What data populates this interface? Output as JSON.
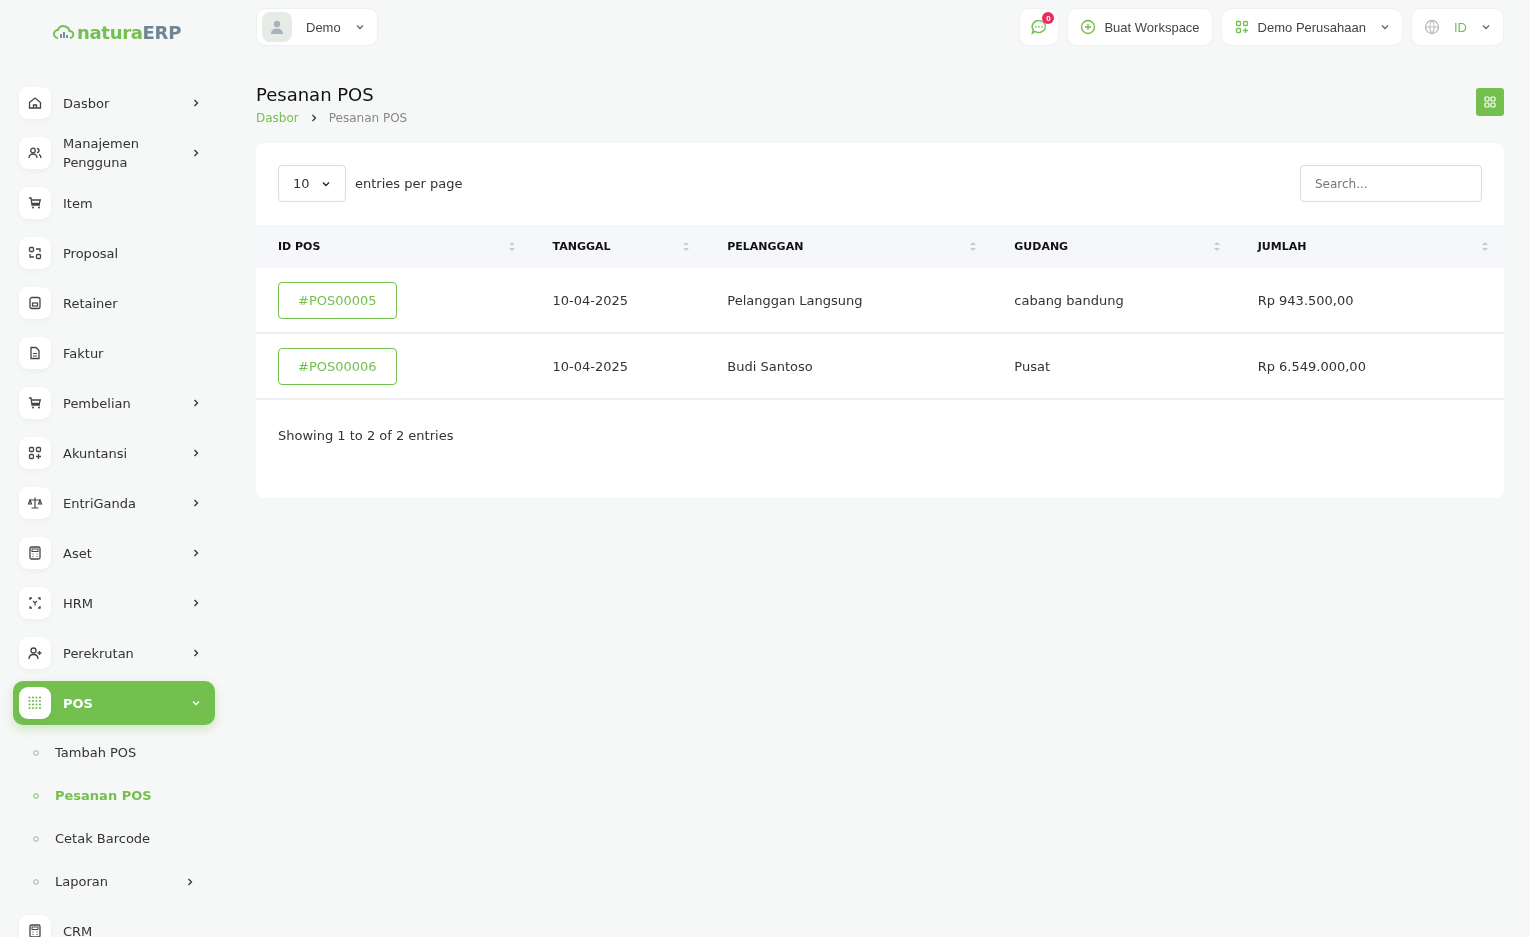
{
  "logo": {
    "part_1": "natura",
    "part_2": "ERP"
  },
  "user_menu": {
    "label": "Demo"
  },
  "topbar": {
    "notification_count": "0",
    "create_workspace": "Buat Workspace",
    "company": "Demo Perusahaan",
    "language": "ID"
  },
  "sidebar": {
    "items": [
      {
        "label": "Dasbor",
        "kind": "home",
        "expandable": true,
        "selected": false
      },
      {
        "label": "Manajemen Pengguna",
        "kind": "users",
        "expandable": true,
        "selected": false
      },
      {
        "label": "Item",
        "kind": "cart",
        "expandable": false,
        "selected": false
      },
      {
        "label": "Proposal",
        "kind": "swap",
        "expandable": false,
        "selected": false
      },
      {
        "label": "Retainer",
        "kind": "save",
        "expandable": false,
        "selected": false
      },
      {
        "label": "Faktur",
        "kind": "file",
        "expandable": false,
        "selected": false
      },
      {
        "label": "Pembelian",
        "kind": "cart",
        "expandable": true,
        "selected": false
      },
      {
        "label": "Akuntansi",
        "kind": "grid",
        "expandable": true,
        "selected": false
      },
      {
        "label": "EntriGanda",
        "kind": "scale",
        "expandable": true,
        "selected": false
      },
      {
        "label": "Aset",
        "kind": "calc",
        "expandable": true,
        "selected": false
      },
      {
        "label": "HRM",
        "kind": "focus",
        "expandable": true,
        "selected": false
      },
      {
        "label": "Perekrutan",
        "kind": "useradd",
        "expandable": true,
        "selected": false
      },
      {
        "label": "POS",
        "kind": "dots",
        "expandable": true,
        "selected": true,
        "expanded": true,
        "children": [
          {
            "label": "Tambah POS",
            "selected": false,
            "expandable": false
          },
          {
            "label": "Pesanan POS",
            "selected": true,
            "expandable": false
          },
          {
            "label": "Cetak Barcode",
            "selected": false,
            "expandable": false
          },
          {
            "label": "Laporan",
            "selected": false,
            "expandable": true
          }
        ]
      },
      {
        "label": "CRM",
        "kind": "calc",
        "expandable": false,
        "selected": false
      }
    ]
  },
  "page": {
    "title": "Pesanan POS",
    "breadcrumb": [
      {
        "label": "Dasbor",
        "link": true
      },
      {
        "label": "Pesanan POS",
        "link": false
      }
    ]
  },
  "table": {
    "page_size": "10",
    "page_size_label": "entries per page",
    "search_placeholder": "Search...",
    "columns": [
      "ID POS",
      "TANGGAL",
      "PELANGGAN",
      "GUDANG",
      "JUMLAH"
    ],
    "rows": [
      {
        "id": "#POS00005",
        "date": "10-04-2025",
        "customer": "Pelanggan Langsung",
        "warehouse": "cabang bandung",
        "amount": "Rp 943.500,00"
      },
      {
        "id": "#POS00006",
        "date": "10-04-2025",
        "customer": "Budi Santoso",
        "warehouse": "Pusat",
        "amount": "Rp 6.549.000,00"
      }
    ],
    "summary": "Showing 1 to 2 of 2 entries"
  }
}
